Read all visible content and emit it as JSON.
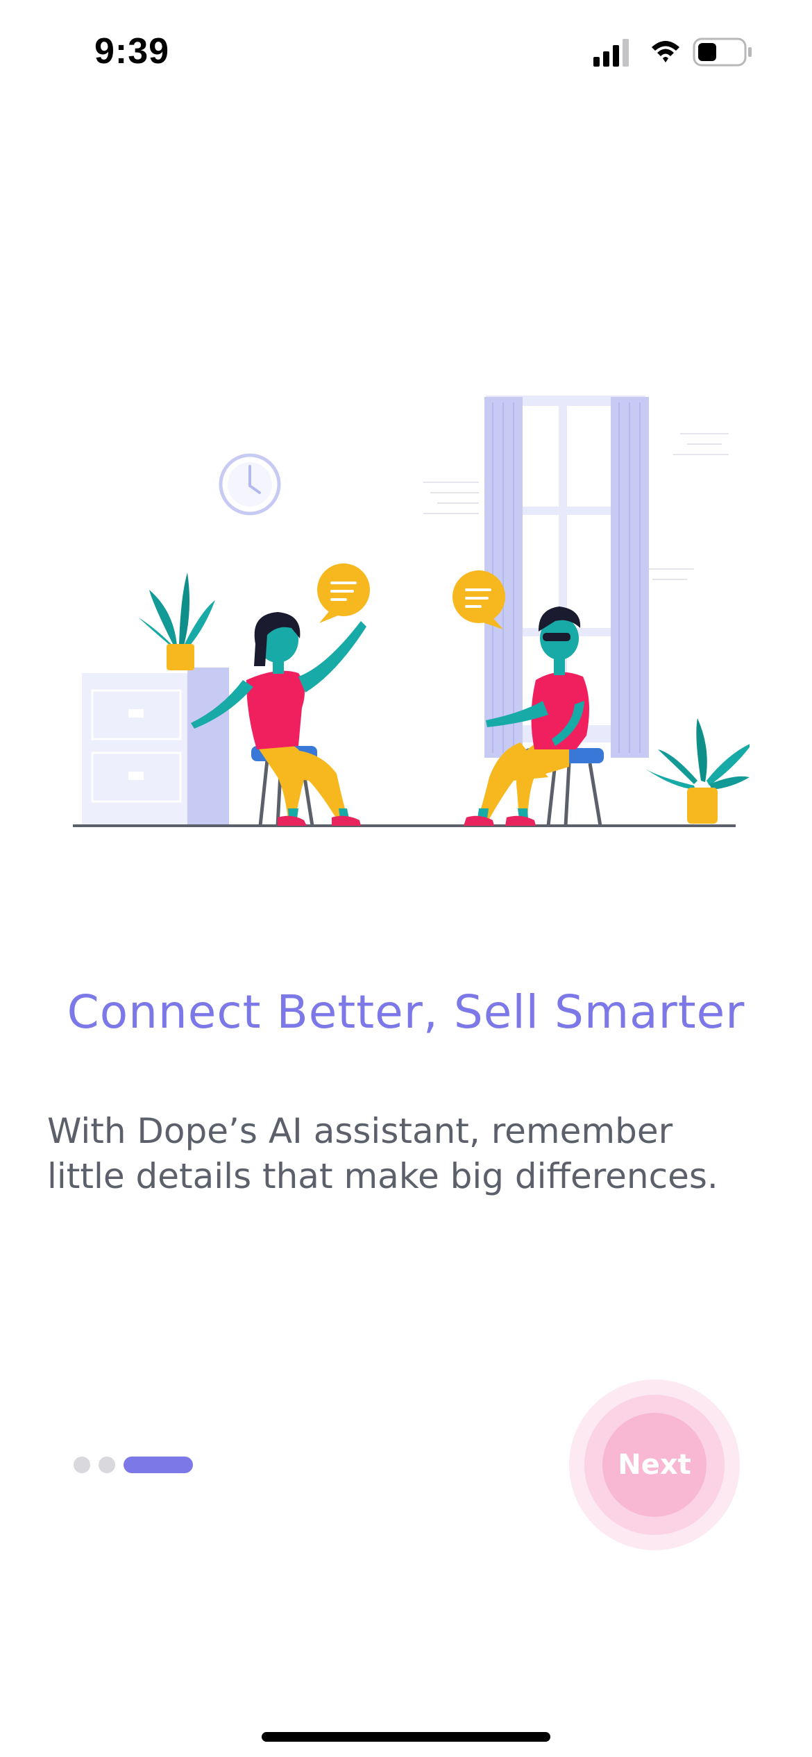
{
  "status_bar": {
    "time": "9:39",
    "icons": [
      "cellular-signal-icon",
      "wifi-icon",
      "battery-icon"
    ]
  },
  "onboarding": {
    "illustration": "two-people-talking-illustration",
    "title": "Connect Better, Sell Smarter",
    "description_lines": [
      "With Dope’s AI assistant, remember",
      "little details that make big differences."
    ],
    "pager": {
      "total": 3,
      "active_index": 2
    },
    "next_label": "Next"
  },
  "colors": {
    "accent": "#7c78e8",
    "next_button": "#f8b8d4",
    "text_body": "#5c606b"
  }
}
